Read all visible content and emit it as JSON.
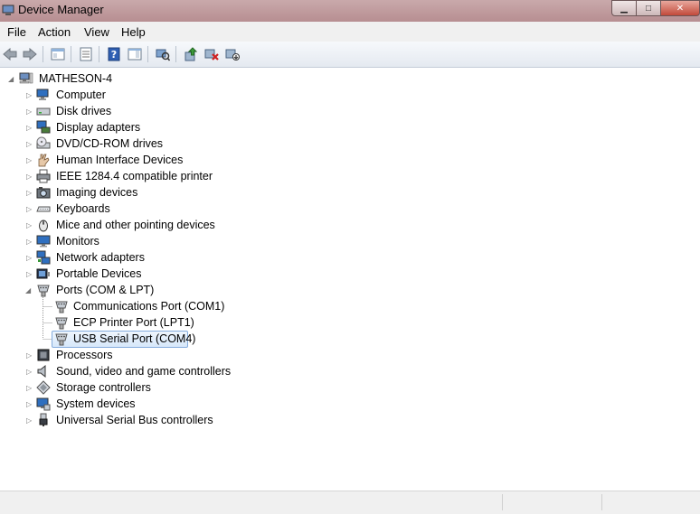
{
  "window": {
    "title": "Device Manager",
    "minimize": "▁",
    "maximize": "□",
    "close": "✕"
  },
  "menu": [
    "File",
    "Action",
    "View",
    "Help"
  ],
  "tree": {
    "root": "MATHESON-4",
    "items": [
      {
        "label": "Computer",
        "icon": "computer-icon"
      },
      {
        "label": "Disk drives",
        "icon": "disk-drive-icon"
      },
      {
        "label": "Display adapters",
        "icon": "display-adapter-icon"
      },
      {
        "label": "DVD/CD-ROM drives",
        "icon": "dvd-drive-icon"
      },
      {
        "label": "Human Interface Devices",
        "icon": "hid-icon"
      },
      {
        "label": "IEEE 1284.4 compatible printer",
        "icon": "printer-icon"
      },
      {
        "label": "Imaging devices",
        "icon": "camera-icon"
      },
      {
        "label": "Keyboards",
        "icon": "keyboard-icon"
      },
      {
        "label": "Mice and other pointing devices",
        "icon": "mouse-icon"
      },
      {
        "label": "Monitors",
        "icon": "monitor-icon"
      },
      {
        "label": "Network adapters",
        "icon": "network-icon"
      },
      {
        "label": "Portable Devices",
        "icon": "portable-device-icon"
      },
      {
        "label": "Ports (COM & LPT)",
        "icon": "port-icon",
        "expanded": true,
        "children": [
          {
            "label": "Communications Port (COM1)",
            "icon": "port-icon"
          },
          {
            "label": "ECP Printer Port (LPT1)",
            "icon": "port-icon"
          },
          {
            "label": "USB Serial Port (COM4)",
            "icon": "port-icon",
            "selected": true
          }
        ]
      },
      {
        "label": "Processors",
        "icon": "processor-icon"
      },
      {
        "label": "Sound, video and game controllers",
        "icon": "speaker-icon"
      },
      {
        "label": "Storage controllers",
        "icon": "storage-icon"
      },
      {
        "label": "System devices",
        "icon": "system-device-icon"
      },
      {
        "label": "Universal Serial Bus controllers",
        "icon": "usb-icon"
      }
    ]
  }
}
